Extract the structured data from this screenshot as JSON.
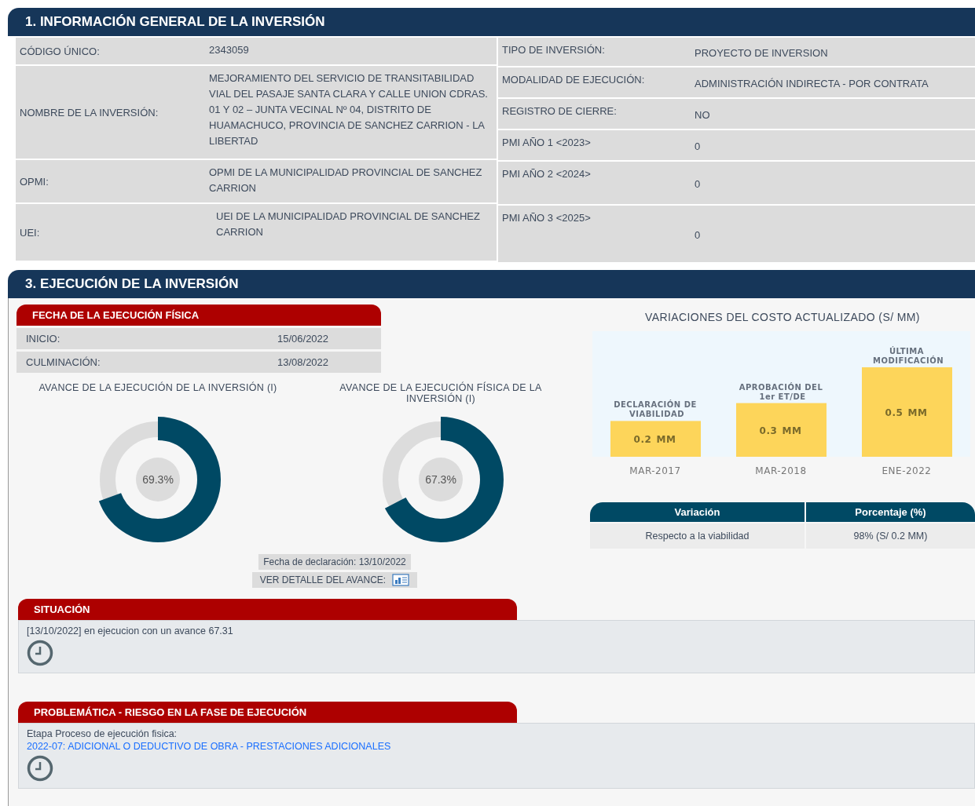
{
  "general": {
    "title": "1. INFORMACIÓN GENERAL DE LA INVERSIÓN",
    "left_rows": [
      {
        "label": "CÓDIGO ÚNICO:",
        "value": "2343059"
      },
      {
        "label": "NOMBRE DE LA INVERSIÓN:",
        "value": "MEJORAMIENTO DEL SERVICIO DE TRANSITABILIDAD VIAL DEL PASAJE SANTA CLARA Y CALLE UNION CDRAS. 01 Y 02 – JUNTA VECINAL Nº 04, DISTRITO DE HUAMACHUCO, PROVINCIA DE SANCHEZ CARRION - LA LIBERTAD"
      },
      {
        "label": "OPMI:",
        "value": "OPMI DE LA MUNICIPALIDAD PROVINCIAL DE SANCHEZ CARRION"
      },
      {
        "label": "UEI:",
        "value": "UEI DE LA MUNICIPALIDAD PROVINCIAL DE SANCHEZ CARRION"
      }
    ],
    "right_rows": [
      {
        "label": "TIPO DE INVERSIÓN:",
        "value": "PROYECTO DE INVERSION"
      },
      {
        "label": "MODALIDAD DE EJECUCIÓN:",
        "value": "ADMINISTRACIÓN INDIRECTA - POR CONTRATA"
      },
      {
        "label": "REGISTRO DE CIERRE:",
        "value": "NO"
      },
      {
        "label": "PMI AÑO 1 <2023>",
        "value": "0"
      },
      {
        "label": "PMI AÑO 2 <2024>",
        "value": "0"
      },
      {
        "label": "PMI AÑO 3 <2025>",
        "value": "0"
      }
    ]
  },
  "execution": {
    "title": "3. EJECUCIÓN DE LA INVERSIÓN",
    "dates": {
      "title": "FECHA DE LA EJECUCIÓN FÍSICA",
      "rows": [
        {
          "label": "INICIO:",
          "value": "15/06/2022"
        },
        {
          "label": "CULMINACIÓN:",
          "value": "13/08/2022"
        }
      ]
    },
    "progress": [
      {
        "title": "AVANCE DE LA EJECUCIÓN DE LA INVERSIÓN (I)",
        "level": 0.693,
        "reading": "69.3%"
      },
      {
        "title": "AVANCE DE LA EJECUCIÓN FÍSICA DE LA INVERSIÓN (I)",
        "level": 0.673,
        "reading": "67.3%"
      }
    ],
    "declaration": "Fecha de declaración: 13/10/2022",
    "detail_link": "VER DETALLE DEL AVANCE:",
    "cost_chart": {
      "chart_data": {
        "type": "bar",
        "title": "VARIACIONES DEL COSTO ACTUALIZADO (S/ MM)",
        "categories": [
          "MAR-2017",
          "MAR-2018",
          "ENE-2022"
        ],
        "series": [
          {
            "color": "#fdd55a",
            "values": [
              0.2,
              0.3,
              0.5
            ]
          }
        ],
        "data_labels": true,
        "annotations": [
          "DECLARACIÓN DE VIABILIDAD",
          "MM",
          "APROBACIÓN DEL 1er ET/DE",
          "MM",
          "ÚLTIMA MODIFICACIÓN",
          "MM"
        ]
      }
    },
    "variation_table": {
      "columns": [
        "Variación",
        "Porcentaje (%)"
      ],
      "rows": [
        [
          "Respecto a la viabilidad",
          "98% (S/ 0.2 MM)"
        ]
      ]
    },
    "situation": {
      "title": "SITUACIÓN",
      "text": "[13/10/2022] en ejecucion con un avance 67.31"
    },
    "problems": {
      "title": "PROBLEMÁTICA - RIESGO EN LA FASE DE EJECUCIÓN",
      "label": "Etapa Proceso de ejecución fisica:",
      "link": "2022-07: ADICIONAL O DEDUCTIVO DE OBRA - PRESTACIONES ADICIONALES"
    }
  }
}
